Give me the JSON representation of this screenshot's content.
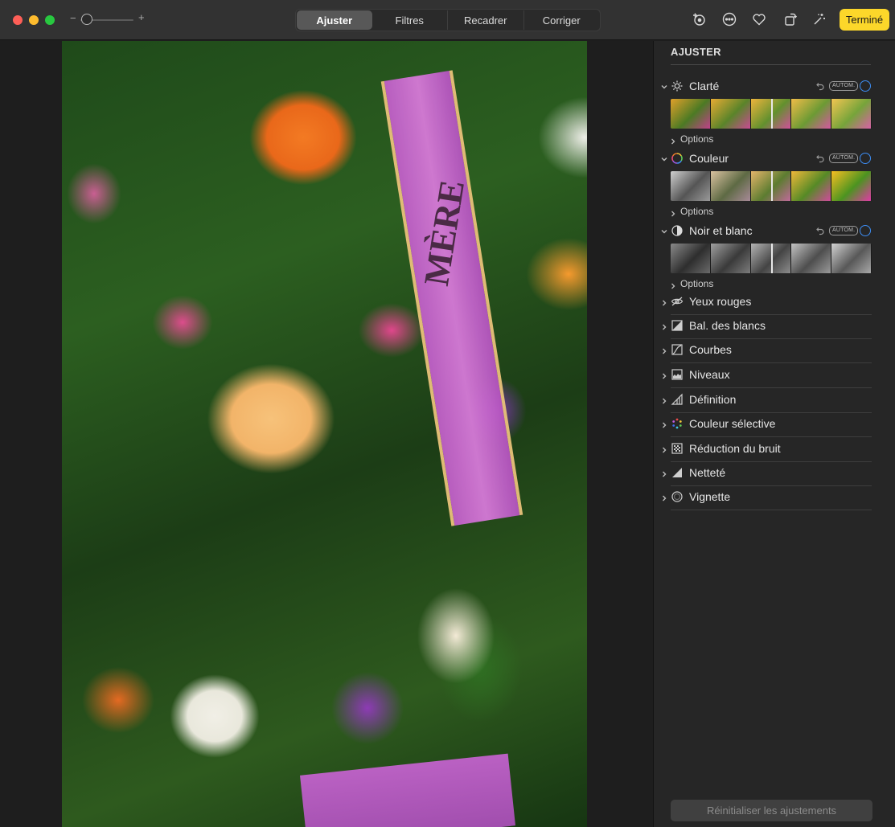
{
  "toolbar": {
    "zoom_minus": "−",
    "zoom_plus": "+",
    "tabs": [
      "Ajuster",
      "Filtres",
      "Recadrer",
      "Corriger"
    ],
    "active_tab": "Ajuster",
    "icons": [
      "add-icon",
      "more-icon",
      "heart-icon",
      "rotate-icon",
      "magic-wand-icon"
    ],
    "done_label": "Terminé",
    "done_color": "#fcd72a"
  },
  "photo": {
    "ribbon_text": "MÈRE"
  },
  "sidebar": {
    "title": "AJUSTER",
    "expanded": [
      {
        "label": "Clarté",
        "icon": "sun-icon",
        "auto": "AUTOM.",
        "options": "Options",
        "style": "color"
      },
      {
        "label": "Couleur",
        "icon": "color-circle-icon",
        "auto": "AUTOM.",
        "options": "Options",
        "style": "color-bw"
      },
      {
        "label": "Noir et blanc",
        "icon": "half-circle-icon",
        "auto": "AUTOM.",
        "options": "Options",
        "style": "bw"
      }
    ],
    "collapsed": [
      {
        "label": "Yeux rouges",
        "icon": "eye-icon"
      },
      {
        "label": "Bal. des blancs",
        "icon": "white-balance-icon"
      },
      {
        "label": "Courbes",
        "icon": "curves-icon"
      },
      {
        "label": "Niveaux",
        "icon": "levels-icon"
      },
      {
        "label": "Définition",
        "icon": "definition-icon"
      },
      {
        "label": "Couleur sélective",
        "icon": "selective-color-icon"
      },
      {
        "label": "Réduction du bruit",
        "icon": "noise-reduction-icon"
      },
      {
        "label": "Netteté",
        "icon": "sharpen-icon"
      },
      {
        "label": "Vignette",
        "icon": "vignette-icon"
      }
    ],
    "reset_label": "Réinitialiser les ajustements",
    "accent_color": "#3d8ef5"
  }
}
